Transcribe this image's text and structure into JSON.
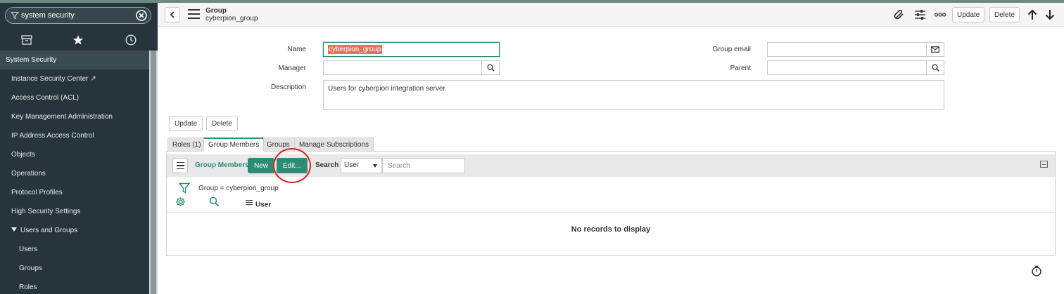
{
  "sidebar": {
    "filter_value": "system security",
    "section_header": "System Security",
    "items": [
      {
        "label": "Instance Security Center ↗"
      },
      {
        "label": "Access Control (ACL)"
      },
      {
        "label": "Key Management Administration"
      },
      {
        "label": "IP Address Access Control"
      },
      {
        "label": "Objects"
      },
      {
        "label": "Operations"
      },
      {
        "label": "Protocol Profiles"
      },
      {
        "label": "High Security Settings"
      },
      {
        "label": "Users and Groups"
      }
    ],
    "sub_items": [
      {
        "label": "Users"
      },
      {
        "label": "Groups"
      },
      {
        "label": "Roles"
      }
    ]
  },
  "header": {
    "record_type": "Group",
    "record_name": "cyberpion_group",
    "update_label": "Update",
    "delete_label": "Delete"
  },
  "form": {
    "name_label": "Name",
    "name_value": "cyberpion_group",
    "manager_label": "Manager",
    "manager_value": "",
    "description_label": "Description",
    "description_value": "Users for cyberpion integration server.",
    "group_email_label": "Group email",
    "group_email_value": "",
    "parent_label": "Parent",
    "parent_value": "",
    "update_label": "Update",
    "delete_label": "Delete"
  },
  "related": {
    "tabs": [
      {
        "label": "Roles (1)"
      },
      {
        "label": "Group Members"
      },
      {
        "label": "Groups"
      },
      {
        "label": "Manage Subscriptions"
      }
    ],
    "active_tab": "Group Members",
    "list_title": "Group Members",
    "new_label": "New",
    "edit_label": "Edit...",
    "search_label": "Search",
    "search_field": "User",
    "search_placeholder": "Search",
    "breadcrumb": "Group = cyberpion_group",
    "column_user": "User",
    "empty_message": "No records to display"
  },
  "colors": {
    "accent": "#2e8b75",
    "sidebar_bg": "#27343b",
    "highlight_circle": "#d8221b",
    "selection": "#e8744f"
  }
}
